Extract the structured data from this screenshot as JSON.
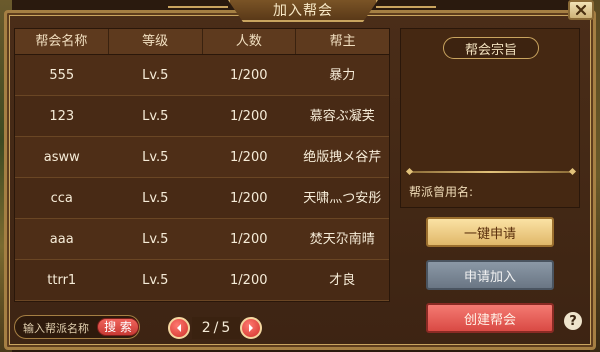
{
  "window": {
    "title": "加入帮会",
    "close_icon": "close-icon"
  },
  "table": {
    "headers": [
      "帮会名称",
      "等级",
      "人数",
      "帮主"
    ],
    "rows": [
      [
        "555",
        "Lv.5",
        "1/200",
        "暴力"
      ],
      [
        "123",
        "Lv.5",
        "1/200",
        "慕容ぶ凝芙"
      ],
      [
        "asww",
        "Lv.5",
        "1/200",
        "绝版拽メ谷芹"
      ],
      [
        "cca",
        "Lv.5",
        "1/200",
        "天啸灬つ安彤"
      ],
      [
        "aaa",
        "Lv.5",
        "1/200",
        "焚天尕南晴"
      ],
      [
        "ttrr1",
        "Lv.5",
        "1/200",
        "才良"
      ]
    ]
  },
  "info": {
    "title": "帮会宗旨",
    "former_name_label": "帮派曾用名:"
  },
  "buttons": {
    "apply_one_click": "一键申请",
    "apply_join": "申请加入",
    "create_guild": "创建帮会",
    "help": "?"
  },
  "search": {
    "placeholder": "输入帮派名称",
    "button": "搜 索"
  },
  "pagination": {
    "current": "2",
    "separator": "/",
    "total": "5"
  },
  "colors": {
    "panel_bg": "#4a2d18",
    "border_gold": "#c9a45f",
    "apply_one_click": "#e0b86a",
    "apply_join": "#6a7684",
    "create_guild": "#d94a44"
  }
}
